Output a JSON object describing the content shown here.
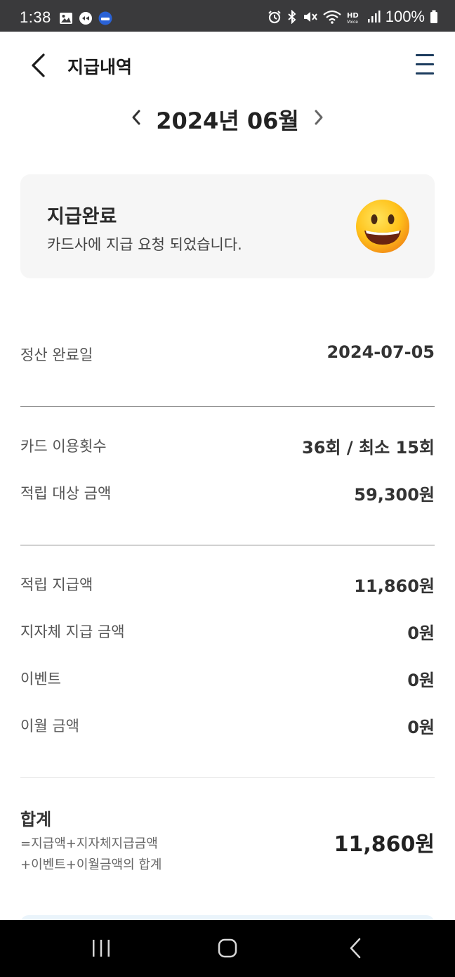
{
  "status_bar": {
    "time": "1:38",
    "battery": "100%",
    "left_icons": [
      "gallery-icon",
      "app-notification-icon",
      "super-sol-icon"
    ],
    "right_icons": [
      "alarm-icon",
      "bluetooth-icon",
      "mute-icon",
      "wifi-icon",
      "hd-voice-icon",
      "signal-icon",
      "battery-icon"
    ]
  },
  "header": {
    "title": "지급내역"
  },
  "month_nav": {
    "label": "2024년 06월"
  },
  "status_card": {
    "title": "지급완료",
    "description": "카드사에 지급 요청 되었습니다."
  },
  "settlement": {
    "label": "정산 완료일",
    "value": "2024-07-05"
  },
  "usage": [
    {
      "label": "카드 이용횟수",
      "value": "36회 / 최소 15회"
    },
    {
      "label": "적립 대상 금액",
      "value": "59,300원"
    }
  ],
  "payments": [
    {
      "label": "적립 지급액",
      "value": "11,860원"
    },
    {
      "label": "지자체 지급 금액",
      "value": "0원"
    },
    {
      "label": "이벤트",
      "value": "0원"
    },
    {
      "label": "이월 금액",
      "value": "0원"
    }
  ],
  "total": {
    "label": "합계",
    "formula_line1": "=지급액+지자체지급금액",
    "formula_line2": "+이벤트+이월금액의 합계",
    "value": "11,860원"
  },
  "colors": {
    "status_bar": "#3a3a3c",
    "menu_icon": "#1d3c5e",
    "card_bg": "#f6f6f6",
    "nav_bar": "#000000"
  }
}
